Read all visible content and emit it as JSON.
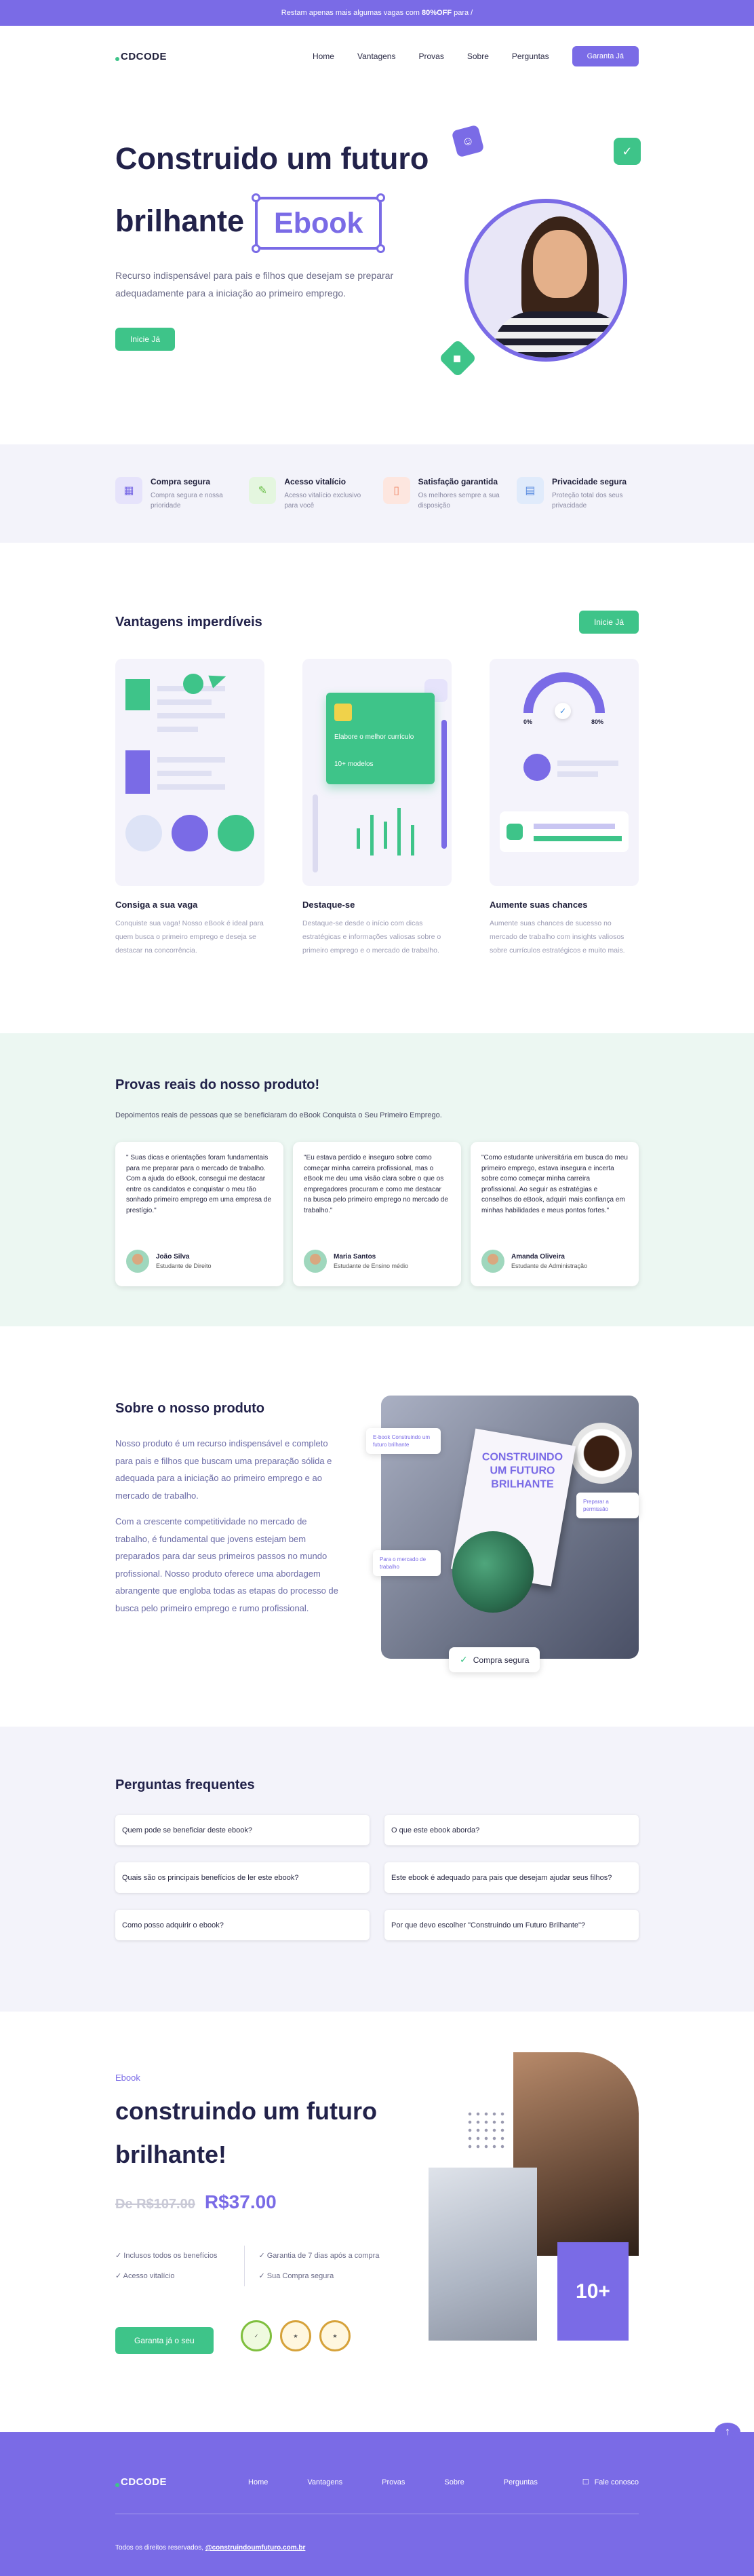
{
  "topbar": {
    "text_before": "Restam apenas mais algumas vagas com ",
    "highlight": "80%OFF",
    "text_after": " para /"
  },
  "nav": {
    "logo": "CDCODE",
    "items": [
      "Home",
      "Vantagens",
      "Provas",
      "Sobre",
      "Perguntas"
    ],
    "cta": "Garanta Já"
  },
  "hero": {
    "title_line1": "Construido um futuro",
    "title_line2": "brilhante",
    "title_highlight": "Ebook",
    "description": "Recurso indispensável para pais e filhos que desejam se preparar adequadamente para a iniciação ao primeiro emprego.",
    "button": "Inicie Já"
  },
  "features": [
    {
      "title": "Compra segura",
      "desc": "Compra segura e nossa prioridade"
    },
    {
      "title": "Acesso vitalício",
      "desc": "Acesso vitalício exclusivo para você"
    },
    {
      "title": "Satisfação garantida",
      "desc": "Os melhores sempre a sua disposição"
    },
    {
      "title": "Privacidade segura",
      "desc": "Proteção total dos seus privacidade"
    }
  ],
  "advantages": {
    "title": "Vantagens imperdíveis",
    "button": "Inicie Já",
    "cards": [
      {
        "title": "Consiga a sua vaga",
        "desc": "Conquiste sua vaga! Nosso eBook é ideal para quem busca o primeiro emprego e deseja se destacar na concorrência."
      },
      {
        "title": "Destaque-se",
        "desc": "Destaque-se desde o início com dicas estratégicas e informações valiosas sobre o primeiro emprego e o mercado de trabalho."
      },
      {
        "title": "Aumente suas chances",
        "desc": "Aumente suas chances de sucesso no mercado de trabalho com insights valiosos sobre currículos estratégicos e muito mais."
      }
    ],
    "card2_label1": "Elabore o melhor currículo",
    "card2_label2": "10+ modelos",
    "card3_pct1": "0%",
    "card3_pct2": "80%"
  },
  "testimonials": {
    "title": "Provas reais do nosso produto!",
    "subtitle": "Depoimentos reais de pessoas que se beneficiaram do eBook Conquista o Seu Primeiro Emprego.",
    "items": [
      {
        "quote": "\" Suas dicas e orientações foram fundamentais para me preparar para o mercado de trabalho. Com a ajuda do eBook, consegui me destacar entre os candidatos e conquistar o meu tão sonhado primeiro emprego em uma empresa de prestígio.\"",
        "name": "João Silva",
        "role": "Estudante de Direito"
      },
      {
        "quote": "\"Eu estava perdido e inseguro sobre como começar minha carreira profissional, mas o eBook me deu uma visão clara sobre o que os empregadores procuram e como me destacar na busca pelo primeiro emprego no mercado de trabalho.\"",
        "name": "Maria Santos",
        "role": "Estudante de Ensino médio"
      },
      {
        "quote": "\"Como estudante universitária em busca do meu primeiro emprego, estava insegura e incerta sobre como começar minha carreira profissional. Ao seguir as estratégias e conselhos do eBook, adquiri mais confiança em minhas habilidades e meus pontos fortes.\"",
        "name": "Amanda Oliveira",
        "role": "Estudante de Administração"
      }
    ]
  },
  "about": {
    "title": "Sobre o nosso produto",
    "p1": "Nosso produto é um recurso indispensável e completo para pais e filhos que buscam uma preparação sólida e adequada para a iniciação ao primeiro emprego e ao mercado de trabalho.",
    "p2": "Com a crescente competitividade no mercado de trabalho, é fundamental que jovens estejam bem preparados para dar seus primeiros passos no mundo profissional. Nosso produto oferece uma abordagem abrangente que engloba todas as etapas do processo de busca pelo primeiro emprego e rumo profissional.",
    "book_title": "CONSTRUINDO UM FUTURO BRILHANTE",
    "chip1": "E-book Construindo um futuro brilhante",
    "chip2": "Preparar a permissão",
    "chip3": "Para o mercado de trabalho",
    "chip_buy": "Compra segura"
  },
  "faq": {
    "title": "Perguntas frequentes",
    "items": [
      "Quem pode se beneficiar deste ebook?",
      "O que este ebook aborda?",
      "Quais são os principais benefícios de ler este ebook?",
      "Este ebook é adequado para pais que desejam ajudar seus filhos?",
      "Como posso adquirir o ebook?",
      "Por que devo escolher \"Construindo um Futuro Brilhante\"?"
    ]
  },
  "cta": {
    "kicker": "Ebook",
    "title": "construindo um futuro brilhante!",
    "old_price": "De R$107.00",
    "new_price": "R$37.00",
    "perks_left": [
      "✓ Inclusos todos os benefícios",
      "✓ Acesso vitalício"
    ],
    "perks_right": [
      "✓ Garantia de 7 dias após a compra",
      "✓ Sua Compra segura"
    ],
    "button": "Garanta já o seu",
    "badge": "10+"
  },
  "footer": {
    "logo": "CDCODE",
    "items": [
      "Home",
      "Vantagens",
      "Provas",
      "Sobre",
      "Perguntas"
    ],
    "contact": "Fale conosco",
    "copy_text": "Todos os direitos reservados, ",
    "copy_link": "@construindoumfuturo.com.br"
  },
  "colors": {
    "accent": "#7a6be6",
    "green": "#3ec489",
    "navy": "#22224a"
  }
}
